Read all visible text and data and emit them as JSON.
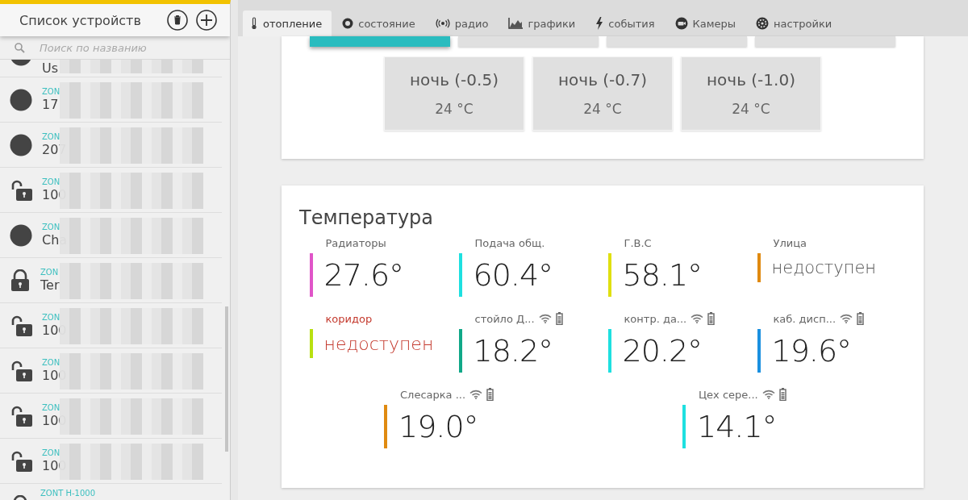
{
  "sidebar": {
    "title": "Список устройств",
    "search": {
      "placeholder": "Поиск по названию"
    },
    "devices": [
      {
        "kind": "dot",
        "name": "Us"
      },
      {
        "kind": "dot",
        "model": "ZON",
        "name": "17"
      },
      {
        "kind": "dot",
        "model": "ZON",
        "name": "207"
      },
      {
        "kind": "unlocked",
        "model": "ZON",
        "name": "100"
      },
      {
        "kind": "dot",
        "model": "ZON",
        "name": "Cha"
      },
      {
        "kind": "locked",
        "model": "ZON",
        "name": "Ter"
      },
      {
        "kind": "unlocked",
        "model": "ZON",
        "name": "100"
      },
      {
        "kind": "unlocked",
        "model": "ZON",
        "name": "100"
      },
      {
        "kind": "unlocked",
        "model": "ZON",
        "name": "100"
      },
      {
        "kind": "unlocked",
        "model": "ZON",
        "name": "100"
      },
      {
        "kind": "locked",
        "model": "ZONT H-1000"
      }
    ]
  },
  "tabs": [
    {
      "label": "отопление",
      "selected": true
    },
    {
      "label": "состояние",
      "selected": false
    },
    {
      "label": "радио",
      "selected": false
    },
    {
      "label": "графики",
      "selected": false
    },
    {
      "label": "события",
      "selected": false
    },
    {
      "label": "Камеры",
      "selected": false
    },
    {
      "label": "настройки",
      "selected": false
    }
  ],
  "modes": {
    "top_row": [
      {
        "selected": true
      },
      {
        "selected": false
      },
      {
        "selected": false
      },
      {
        "selected": false
      }
    ],
    "presets": [
      {
        "name": "ночь (-0.5)",
        "temp": "24 °C"
      },
      {
        "name": "ночь (-0.7)",
        "temp": "24 °C"
      },
      {
        "name": "ночь (-1.0)",
        "temp": "24 °C"
      }
    ]
  },
  "temperature": {
    "title": "Температура",
    "rows": [
      [
        {
          "label": "Радиаторы",
          "value": "27.6°",
          "color": "#e055c8",
          "available": true,
          "alarm": false,
          "wireless": false
        },
        {
          "label": "Подача общ.",
          "value": "60.4°",
          "color": "#1ee0e0",
          "available": true,
          "alarm": false,
          "wireless": false
        },
        {
          "label": "Г.В.С",
          "value": "58.1°",
          "color": "#e0e010",
          "available": true,
          "alarm": false,
          "wireless": false
        },
        {
          "label": "Улица",
          "value": "недоступен",
          "color": "#e08a10",
          "available": false,
          "alarm": false,
          "wireless": false
        }
      ],
      [
        {
          "label": "коридор",
          "value": "недоступен",
          "color": "#b8e010",
          "available": false,
          "alarm": true,
          "wireless": false
        },
        {
          "label": "стойло Д...",
          "value": "18.2°",
          "color": "#10a888",
          "available": true,
          "alarm": false,
          "wireless": true
        },
        {
          "label": "контр. да...",
          "value": "20.2°",
          "color": "#1ee0e0",
          "available": true,
          "alarm": false,
          "wireless": true
        },
        {
          "label": "каб. дисп...",
          "value": "19.6°",
          "color": "#1a90e0",
          "available": true,
          "alarm": false,
          "wireless": true
        }
      ],
      [
        {
          "label": "Слесарка ...",
          "value": "19.0°",
          "color": "#e08a10",
          "available": true,
          "alarm": false,
          "wireless": true
        },
        {
          "label": "Цех сере...",
          "value": "14.1°",
          "color": "#1ee0e0",
          "available": true,
          "alarm": false,
          "wireless": true
        }
      ]
    ]
  }
}
